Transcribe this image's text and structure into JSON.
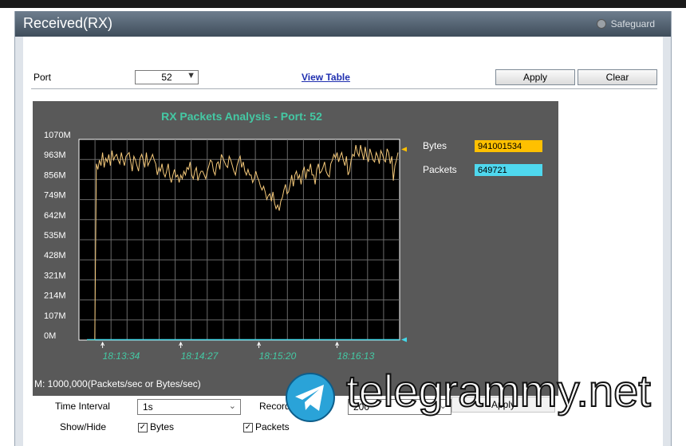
{
  "window": {
    "title": "Received(RX)",
    "safeguard_label": "Safeguard"
  },
  "port": {
    "label": "Port",
    "value": "52"
  },
  "view_table": "View Table",
  "buttons": {
    "apply": "Apply",
    "clear": "Clear"
  },
  "chart_data": {
    "type": "line",
    "title": "RX Packets Analysis - Port: 52",
    "y_tick_labels": [
      "1070M",
      "963M",
      "856M",
      "749M",
      "642M",
      "535M",
      "428M",
      "321M",
      "214M",
      "107M",
      "0M"
    ],
    "ylim": [
      0,
      1070
    ],
    "x_tick_labels": [
      "18:13:34",
      "18:14:27",
      "18:15:20",
      "18:16:13"
    ],
    "x_tick_positions": [
      10,
      60,
      110,
      160
    ],
    "x_count": 200,
    "grid": true,
    "series": [
      {
        "name": "Bytes",
        "color": "#f5c97a",
        "values": [
          0,
          0,
          0,
          0,
          0,
          0,
          940,
          910,
          960,
          930,
          1000,
          920,
          970,
          950,
          990,
          930,
          1010,
          960,
          980,
          990,
          960,
          940,
          1000,
          960,
          930,
          980,
          990,
          1000,
          950,
          900,
          980,
          960,
          930,
          900,
          970,
          990,
          960,
          920,
          1000,
          930,
          950,
          970,
          990,
          960,
          940,
          880,
          920,
          900,
          940,
          890,
          870,
          900,
          940,
          870,
          840,
          880,
          910,
          870,
          880,
          840,
          880,
          860,
          900,
          880,
          920,
          910,
          950,
          880,
          860,
          900,
          920,
          850,
          880,
          900,
          900,
          880,
          860,
          900,
          930,
          960,
          950,
          900,
          880,
          940,
          950,
          910,
          990,
          970,
          950,
          930,
          920,
          980,
          960,
          930,
          900,
          880,
          930,
          960,
          980,
          920,
          950,
          900,
          880,
          910,
          880,
          880,
          840,
          860,
          900,
          870,
          850,
          820,
          800,
          820,
          790,
          750,
          770,
          780,
          740,
          790,
          730,
          700,
          720,
          690,
          740,
          760,
          800,
          830,
          780,
          790,
          830,
          880,
          820,
          880,
          900,
          860,
          880,
          830,
          900,
          920,
          860,
          910,
          900,
          940,
          880,
          880,
          830,
          910,
          940,
          890,
          900,
          920,
          950,
          900,
          880,
          870,
          940,
          960,
          990,
          970,
          1000,
          950,
          980,
          1000,
          960,
          930,
          980,
          880,
          900,
          960,
          990,
          980,
          1040,
          1000,
          980,
          1040,
          1000,
          960,
          1030,
          980,
          950,
          1020,
          990,
          960,
          950,
          1000,
          980,
          940,
          1010,
          990,
          960,
          950,
          1020,
          1000,
          940,
          980,
          850,
          930,
          960,
          1000
        ]
      },
      {
        "name": "Packets",
        "color": "#44d7e8",
        "values": [
          0,
          0
        ]
      }
    ],
    "legend": [
      {
        "label": "Bytes",
        "value": "941001534",
        "color": "#ffc000"
      },
      {
        "label": "Packets",
        "value": "649721",
        "color": "#4fd8ee"
      }
    ],
    "footnote": "M: 1000,000(Packets/sec or Bytes/sec)"
  },
  "controls": {
    "time_interval_label": "Time Interval",
    "time_interval_value": "1s",
    "record_number_label": "Record N",
    "record_number_value": "200",
    "apply_label": "Apply",
    "show_hide_label": "Show/Hide",
    "bytes_label": "Bytes",
    "packets_label": "Packets"
  },
  "watermark": {
    "text": "telegrammy.net"
  }
}
